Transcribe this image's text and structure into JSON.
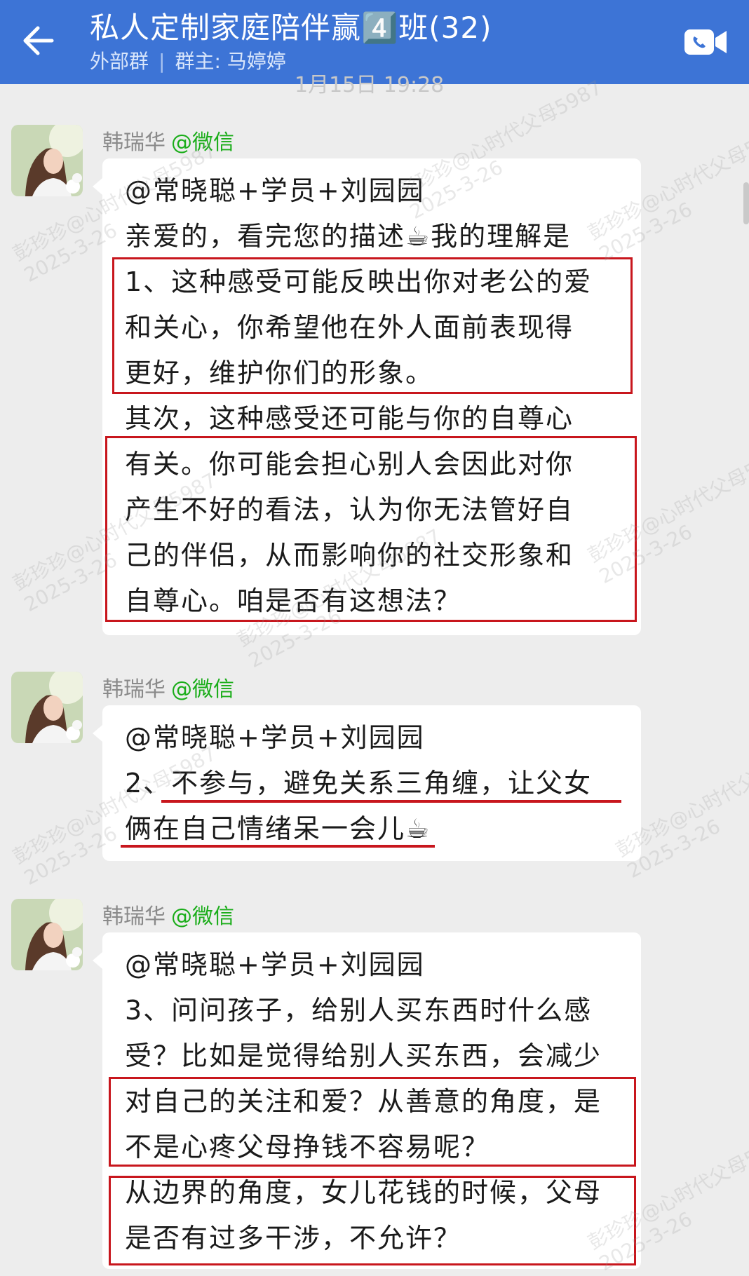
{
  "header": {
    "title": "私人定制家庭陪伴赢4️⃣班(32)",
    "group_type": "外部群",
    "owner": "群主: 马婷婷"
  },
  "date_ghost": "1月15日 19:28",
  "messages": [
    {
      "sender": "韩瑞华",
      "source": "@微信",
      "lines": [
        "@常晓聪+学员+刘园园",
        "亲爱的，看完您的描述☕我的理解是",
        "1、这种感受可能反映出你对老公的爱",
        "和关心，你希望他在外人面前表现得",
        "更好，维护你们的形象。",
        "其次，这种感受还可能与你的自尊心",
        "有关。你可能会担心别人会因此对你",
        "产生不好的看法，认为你无法管好自",
        "己的伴侣，从而影响你的社交形象和",
        "自尊心。咱是否有这想法？"
      ]
    },
    {
      "sender": "韩瑞华",
      "source": "@微信",
      "lines": [
        "@常晓聪+学员+刘园园",
        "2、不参与，避免关系三角缠，让父女",
        "俩在自己情绪呆一会儿☕"
      ]
    },
    {
      "sender": "韩瑞华",
      "source": "@微信",
      "lines": [
        "@常晓聪+学员+刘园园",
        "3、问问孩子，给别人买东西时什么感",
        "受？比如是觉得给别人买东西，会减少",
        "对自己的关注和爱？从善意的角度，是",
        "不是心疼父母挣钱不容易呢？",
        "从边界的角度，女儿花钱的时候，父母",
        "是否有过多干涉，不允许？"
      ]
    }
  ],
  "watermarks": [
    "彭珍珍@心时代父母5987",
    "2025-3-26"
  ],
  "colors": {
    "header_bg": "#3d74d6",
    "chat_bg": "#ededed",
    "highlight_red": "#c8161d",
    "source_green": "#1aad19"
  }
}
